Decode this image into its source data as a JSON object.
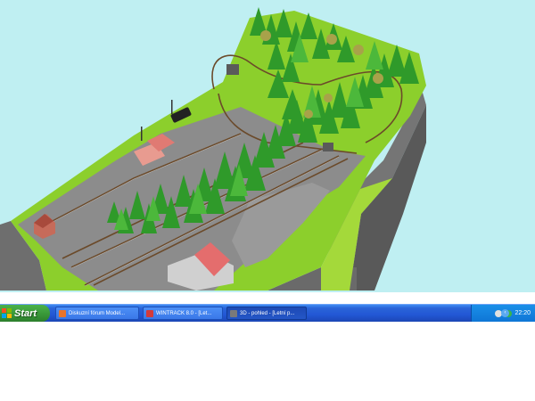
{
  "taskbar": {
    "start_label": "Start",
    "tasks": [
      {
        "label": "Diskuzní fórum Model...",
        "icon": "firefox-icon"
      },
      {
        "label": "WINTRACK 8.0 - [Let...",
        "icon": "wintrack-icon"
      },
      {
        "label": "3D - pohled - [Letní p...",
        "icon": "3d-view-icon",
        "active": true
      }
    ],
    "tray": {
      "clock": "22:20",
      "icons": [
        "network-icon",
        "antivirus-icon",
        "shield-icon"
      ]
    }
  },
  "viewport": {
    "scene": "3d-model-railway-layout",
    "sky_color": "#bfeff2",
    "grass_color": "#8ccf2c",
    "forest_color": "#2f9a2a",
    "rock_color": "#7b7b7b"
  }
}
